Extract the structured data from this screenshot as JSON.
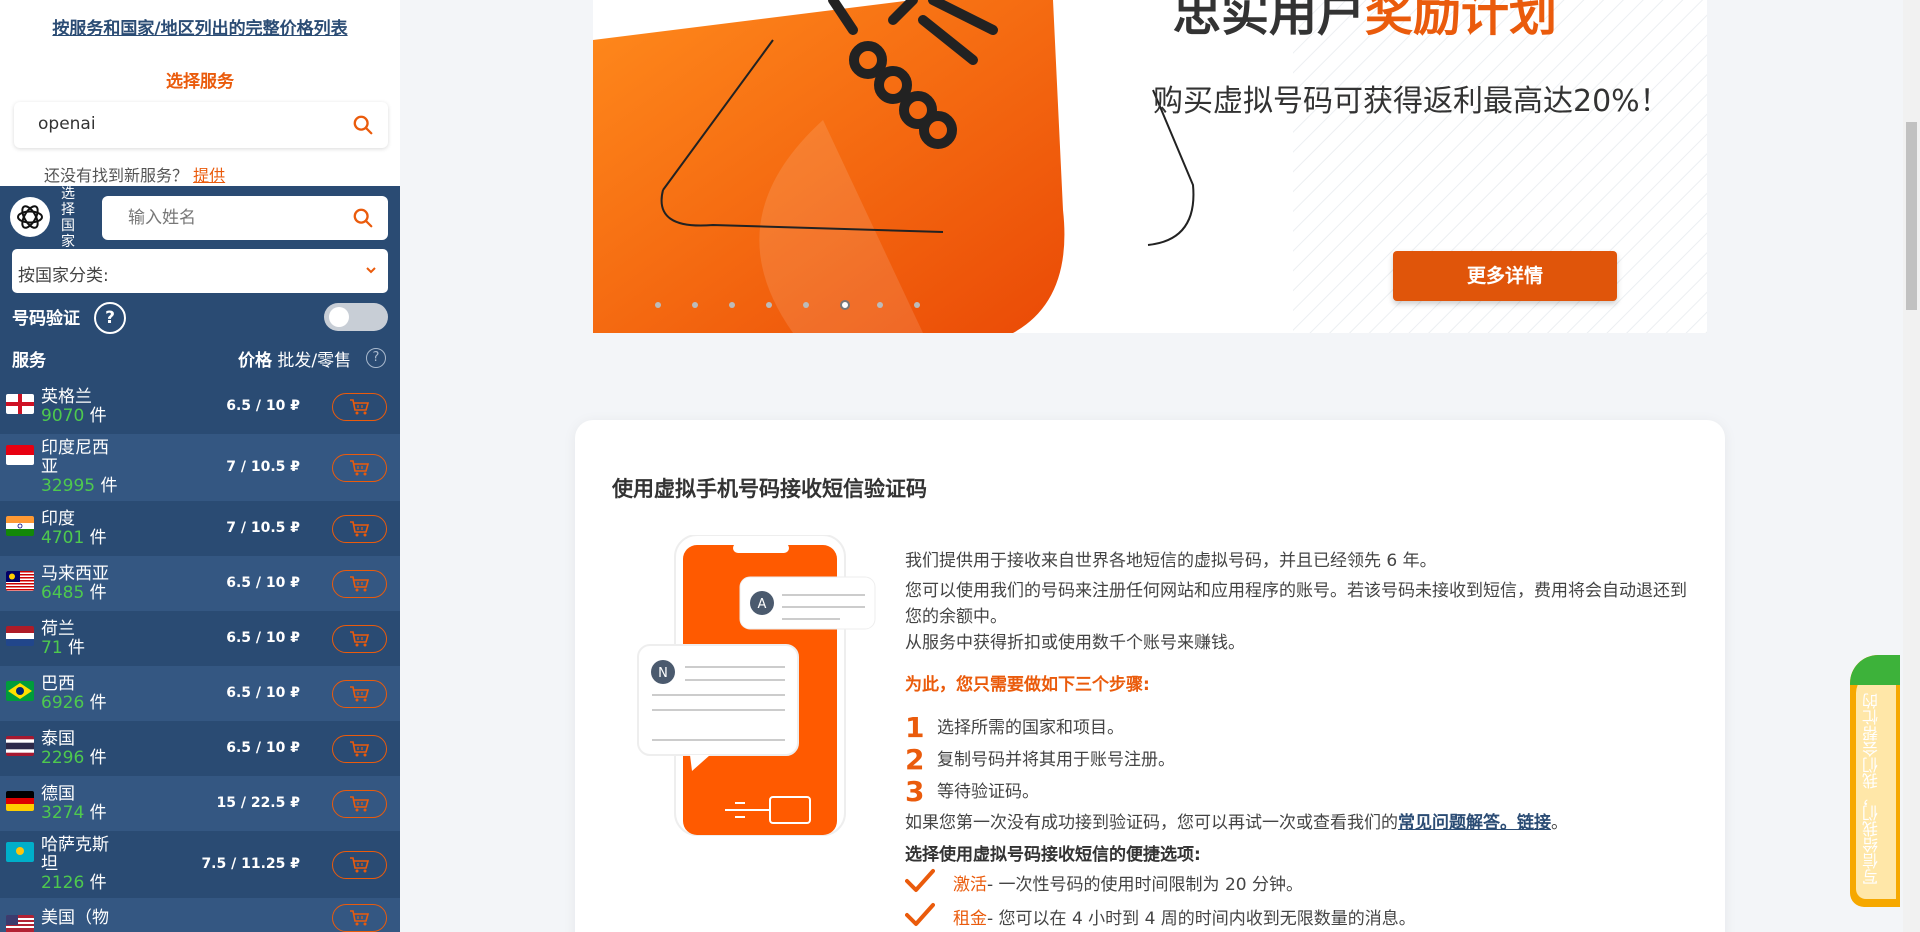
{
  "sidebar": {
    "price_list_link": "按服务和国家/地区列出的完整价格列表",
    "select_service_label": "选择服务",
    "service_search": {
      "value": "openai"
    },
    "not_found_text": "还没有找到新服务？",
    "offer_link": "提供",
    "choose_country_label": "选择国家",
    "country_search": {
      "placeholder": "输入姓名"
    },
    "category_select_label": "按国家分类:",
    "verification_label": "号码验证",
    "help_label": "?",
    "list_header": {
      "service": "服务",
      "price": "价格",
      "price_type": "批发/零售",
      "help": "?"
    },
    "countries": [
      {
        "name": "英格兰",
        "count": "9070",
        "unit": "件",
        "price": "6.5 / 10 ₽",
        "flag": "england-flag-icon"
      },
      {
        "name": "印度尼西亚",
        "count": "32995",
        "unit": "件",
        "price": "7 / 10.5 ₽",
        "flag": "indonesia-flag-icon"
      },
      {
        "name": "印度",
        "count": "4701",
        "unit": "件",
        "price": "7 / 10.5 ₽",
        "flag": "india-flag-icon"
      },
      {
        "name": "马来西亚",
        "count": "6485",
        "unit": "件",
        "price": "6.5 / 10 ₽",
        "flag": "malaysia-flag-icon"
      },
      {
        "name": "荷兰",
        "count": "71",
        "unit": "件",
        "price": "6.5 / 10 ₽",
        "flag": "netherlands-flag-icon"
      },
      {
        "name": "巴西",
        "count": "6926",
        "unit": "件",
        "price": "6.5 / 10 ₽",
        "flag": "brazil-flag-icon"
      },
      {
        "name": "泰国",
        "count": "2296",
        "unit": "件",
        "price": "6.5 / 10 ₽",
        "flag": "thailand-flag-icon"
      },
      {
        "name": "德国",
        "count": "3274",
        "unit": "件",
        "price": "15 / 22.5 ₽",
        "flag": "germany-flag-icon"
      },
      {
        "name": "哈萨克斯坦",
        "count": "2126",
        "unit": "件",
        "price": "7.5 / 11.25 ₽",
        "flag": "kazakhstan-flag-icon"
      },
      {
        "name": "美国（物",
        "count": "",
        "unit": "",
        "price": "",
        "flag": "usa-flag-icon"
      }
    ]
  },
  "banner": {
    "title_part1": "忠实用户",
    "title_part2": "奖励计划",
    "subtitle": "购买虚拟号码可获得返利最高达20%！",
    "details_button": "更多详情",
    "carousel_active_index": 5,
    "carousel_count": 8
  },
  "info": {
    "title": "使用虚拟手机号码接收短信验证码",
    "p1": "我们提供用于接收来自世界各地短信的虚拟号码，并且已经领先 6 年。",
    "p2": "您可以使用我们的号码来注册任何网站和应用程序的账号。若该号码未接收到短信，费用将会自动退还到您的余额中。",
    "p3": "从服务中获得折扣或使用数千个账号来赚钱。",
    "steps_heading": "为此，您只需要做如下三个步骤:",
    "steps": [
      {
        "num": "1",
        "text": "选择所需的国家和项目。"
      },
      {
        "num": "2",
        "text": "复制号码并将其用于账号注册。"
      },
      {
        "num": "3",
        "text": "等待验证码。"
      }
    ],
    "retry_text": "如果您第一次没有成功接到验证码，您可以再试一次或查看我们的",
    "faq_link": "常见问题解答。链接",
    "retry_end": "。",
    "options_heading": "选择使用虚拟号码接收短信的便捷选项:",
    "options": [
      {
        "keyword": "激活",
        "text": " - 一次性号码的使用时间限制为 20 分钟。"
      },
      {
        "keyword": "租金",
        "text": " - 您可以在 4 小时到 4 周的时间内收到无限数量的消息。"
      }
    ],
    "illustration_letters": [
      "A",
      "N"
    ]
  },
  "feedback_tab": {
    "text": "写信给我们，我们会帮忙的"
  },
  "colors": {
    "accent": "#ea5b0c",
    "sidebar_dark": "#2a4b73",
    "sidebar_row_alt": "#345782",
    "count_green": "#4ec94e",
    "link_blue": "#2b4c74"
  }
}
